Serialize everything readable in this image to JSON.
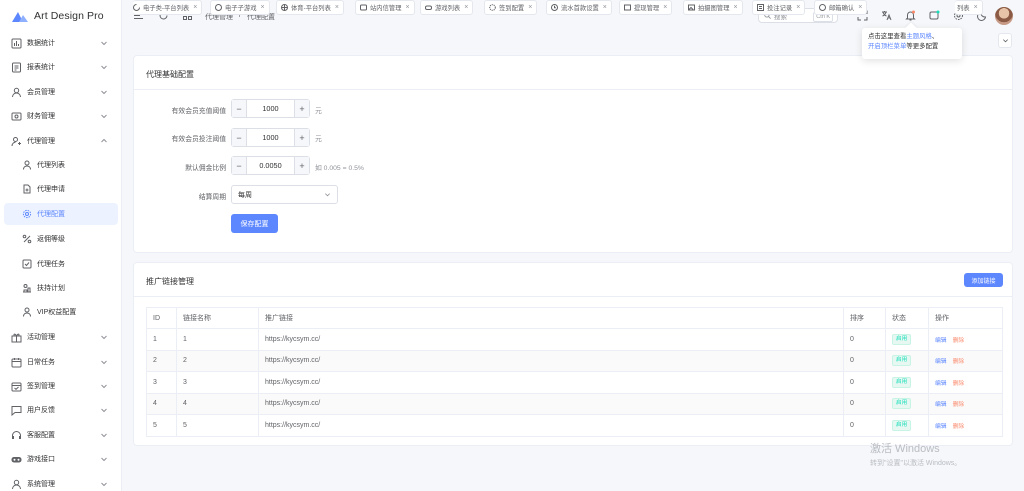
{
  "app": {
    "title": "Art Design Pro",
    "accent": "#5d87ff"
  },
  "sidebar": {
    "groups": [
      {
        "label": "数据统计",
        "icon": "chart-icon"
      },
      {
        "label": "报表统计",
        "icon": "report-icon"
      },
      {
        "label": "会员管理",
        "icon": "user-icon"
      },
      {
        "label": "财务管理",
        "icon": "finance-icon"
      },
      {
        "label": "代理管理",
        "icon": "agent-icon",
        "expanded": true
      }
    ],
    "sub": [
      {
        "label": "代理列表",
        "icon": "user-icon"
      },
      {
        "label": "代理申请",
        "icon": "document-icon"
      },
      {
        "label": "代理配置",
        "icon": "gear-icon",
        "active": true
      },
      {
        "label": "返佣等级",
        "icon": "percent-icon"
      },
      {
        "label": "代理任务",
        "icon": "checkbox-icon"
      },
      {
        "label": "扶持计划",
        "icon": "plan-icon"
      },
      {
        "label": "VIP权益配置",
        "icon": "vip-icon"
      }
    ],
    "rest": [
      {
        "label": "活动管理",
        "icon": "gift-icon"
      },
      {
        "label": "日常任务",
        "icon": "calendar-icon"
      },
      {
        "label": "签到管理",
        "icon": "calendar-check-icon"
      },
      {
        "label": "用户反馈",
        "icon": "feedback-icon"
      },
      {
        "label": "客服配置",
        "icon": "headset-icon"
      },
      {
        "label": "游戏接口",
        "icon": "gamepad-icon"
      },
      {
        "label": "系统管理",
        "icon": "user-icon"
      }
    ]
  },
  "header": {
    "breadcrumb": [
      "代理管理",
      "/",
      "代理配置"
    ],
    "search": {
      "placeholder": "搜索",
      "shortcut": "Ctrl K"
    }
  },
  "tabs": [
    "电子类-平台列表",
    "电子子游戏",
    "体育-平台列表",
    "站内信管理",
    "游戏列表",
    "签到配置",
    "流水首款设置",
    "提现管理",
    "拍摄图管理",
    "投注记录",
    "邮箱确认",
    "列表"
  ],
  "tooltip": {
    "line1": "点击这里查看",
    "link1": "主题风格",
    "sep": "、",
    "link2": "开启顶栏菜单",
    "line2": "等更多配置"
  },
  "config": {
    "title": "代理基础配置",
    "fields": [
      {
        "label": "有效会员充值阈值",
        "value": "1000",
        "suffix": "元"
      },
      {
        "label": "有效会员投注阈值",
        "value": "1000",
        "suffix": "元"
      },
      {
        "label": "默认佣金比例",
        "value": "0.0050",
        "suffix": "如 0.005 = 0.5%"
      }
    ],
    "period": {
      "label": "结算周期",
      "value": "每周"
    },
    "save": "保存配置"
  },
  "links": {
    "title": "推广链接管理",
    "add": "添加链接",
    "columns": [
      "ID",
      "链接名称",
      "推广链接",
      "排序",
      "状态",
      "操作"
    ],
    "rows": [
      {
        "id": "1",
        "name": "1",
        "url": "https://kycsym.cc/",
        "order": "0",
        "status": "启用"
      },
      {
        "id": "2",
        "name": "2",
        "url": "https://kycsym.cc/",
        "order": "0",
        "status": "启用"
      },
      {
        "id": "3",
        "name": "3",
        "url": "https://kycsym.cc/",
        "order": "0",
        "status": "启用"
      },
      {
        "id": "4",
        "name": "4",
        "url": "https://kycsym.cc/",
        "order": "0",
        "status": "启用"
      },
      {
        "id": "5",
        "name": "5",
        "url": "https://kycsym.cc/",
        "order": "0",
        "status": "启用"
      }
    ],
    "edit": "编辑",
    "delete": "删除"
  },
  "watermark": {
    "line1": "激活 Windows",
    "line2": "转到\"设置\"以激活 Windows。"
  }
}
